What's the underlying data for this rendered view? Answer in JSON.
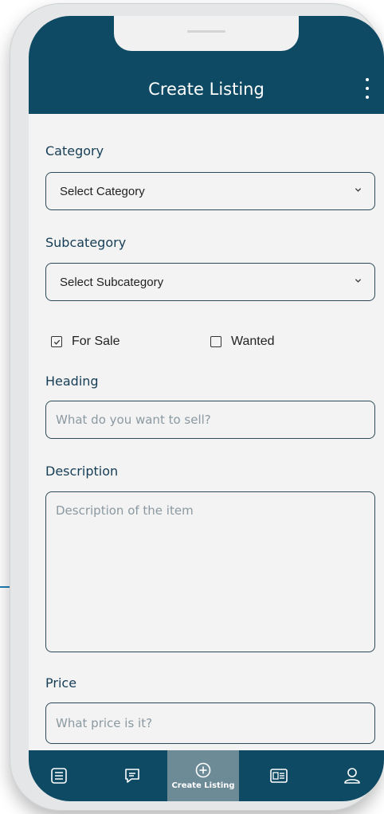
{
  "header": {
    "title": "Create Listing"
  },
  "form": {
    "category_label": "Category",
    "category_value": "Select Category",
    "subcategory_label": "Subcategory",
    "subcategory_value": "Select Subcategory",
    "for_sale_label": "For Sale",
    "for_sale_checked": true,
    "wanted_label": "Wanted",
    "wanted_checked": false,
    "heading_label": "Heading",
    "heading_placeholder": "What do you want to sell?",
    "description_label": "Description",
    "description_placeholder": "Description of the item",
    "price_label": "Price",
    "price_placeholder": "What price is it?"
  },
  "bottom_nav": {
    "items": [
      {
        "icon": "list-icon"
      },
      {
        "icon": "message-icon"
      },
      {
        "icon": "add-circle-icon",
        "label": "Create Listing",
        "active": true
      },
      {
        "icon": "newspaper-icon"
      },
      {
        "icon": "user-icon"
      }
    ]
  },
  "colors": {
    "primary": "#0e4a63",
    "active_tab": "#6d8a97",
    "background": "#f3f3f3"
  }
}
